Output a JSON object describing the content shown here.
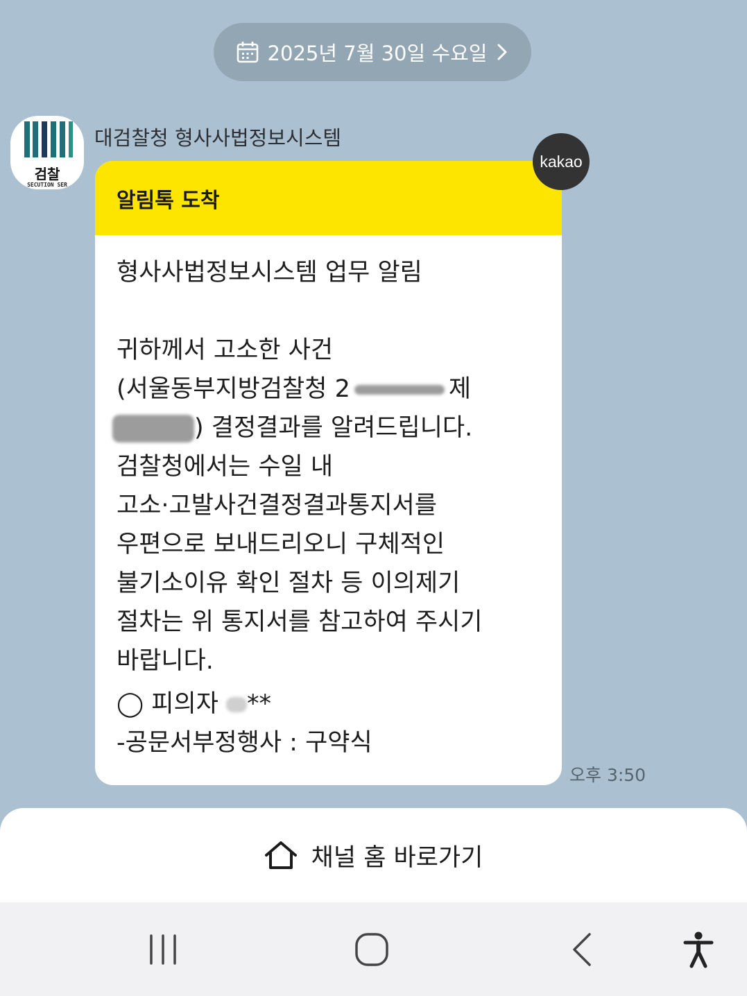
{
  "date_header": {
    "text": "2025년 7월 30일 수요일",
    "icon": "calendar-icon",
    "chevron": "chevron-right-icon"
  },
  "sender": {
    "name": "대검찰청 형사사법정보시스템",
    "avatar_text": "검찰",
    "avatar_subtext": "SECUTION SER",
    "avatar_color": "#1d6f78"
  },
  "message": {
    "header": "알림톡 도착",
    "badge": "kakao",
    "title": "형사사법정보시스템 업무 알림",
    "line_1": "귀하께서 고소한 사건",
    "line_2_prefix": "(서울동부지방검찰청 2",
    "line_2_suffix": "제",
    "line_3_suffix": ") 결정결과를 알려드립니다.",
    "line_4": "검찰청에서는 수일 내",
    "line_5": "고소·고발사건결정결과통지서를",
    "line_6": "우편으로 보내드리오니 구체적인",
    "line_7": "불기소이유 확인 절차 등 이의제기",
    "line_8": "절차는 위 통지서를 참고하여 주시기",
    "line_9": "바랍니다.",
    "line_10_prefix": "◯ 피의자 ",
    "line_10_suffix": "**",
    "line_11": "-공문서부정행사 : 구약식",
    "timestamp": "오후 3:50",
    "header_color": "#fee500"
  },
  "channel_home": {
    "label": "채널 홈 바로가기",
    "icon": "home-icon"
  },
  "nav": {
    "recent": "recent-apps-icon",
    "home": "home-circle-icon",
    "back": "back-icon",
    "accessibility": "accessibility-icon"
  },
  "colors": {
    "chat_background": "#abc1d1",
    "date_pill": "#93a6b4",
    "kakao_yellow": "#fee500"
  }
}
